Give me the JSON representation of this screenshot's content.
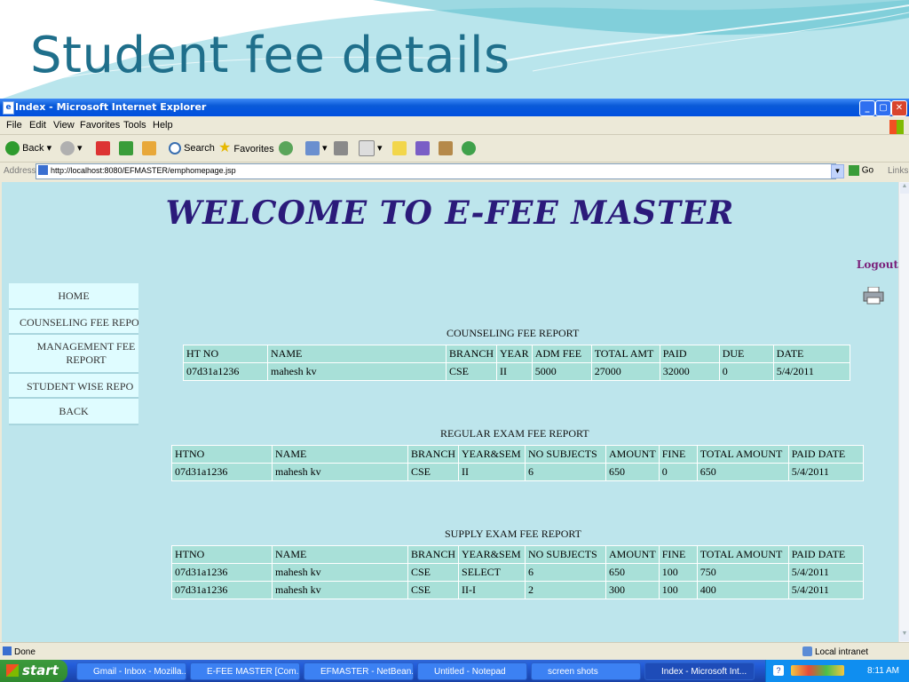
{
  "slide": {
    "title": "Student fee details"
  },
  "window": {
    "title": "Index - Microsoft Internet Explorer"
  },
  "menu": [
    "File",
    "Edit",
    "View",
    "Favorites",
    "Tools",
    "Help"
  ],
  "toolbar": {
    "back": "Back",
    "search": "Search",
    "favorites": "Favorites"
  },
  "address": {
    "label": "Address",
    "url": "http://localhost:8080/EFMASTER/emphomepage.jsp",
    "go": "Go",
    "links": "Links"
  },
  "page": {
    "heading": "WELCOME TO E-FEE MASTER",
    "logout": "Logout",
    "nav": [
      "HOME",
      "COUNSELING FEE REPO",
      "MANAGEMENT FEE REPORT",
      "STUDENT WISE REPO",
      "BACK"
    ],
    "counseling": {
      "title": "COUNSELING FEE REPORT",
      "headers": [
        "HT NO",
        "NAME",
        "BRANCH",
        "YEAR",
        "ADM FEE",
        "TOTAL AMT",
        "PAID",
        "DUE",
        "DATE"
      ],
      "rows": [
        [
          "07d31a1236",
          "mahesh kv",
          "CSE",
          "II",
          "5000",
          "27000",
          "32000",
          "0",
          "5/4/2011"
        ]
      ]
    },
    "regular": {
      "title": "REGULAR EXAM FEE REPORT",
      "headers": [
        "HTNO",
        "NAME",
        "BRANCH",
        "YEAR&SEM",
        "NO SUBJECTS",
        "AMOUNT",
        "FINE",
        "TOTAL AMOUNT",
        "PAID DATE"
      ],
      "rows": [
        [
          "07d31a1236",
          "mahesh kv",
          "CSE",
          "II",
          "6",
          "650",
          "0",
          "650",
          "5/4/2011"
        ]
      ]
    },
    "supply": {
      "title": "SUPPLY EXAM FEE REPORT",
      "headers": [
        "HTNO",
        "NAME",
        "BRANCH",
        "YEAR&SEM",
        "NO SUBJECTS",
        "AMOUNT",
        "FINE",
        "TOTAL AMOUNT",
        "PAID DATE"
      ],
      "rows": [
        [
          "07d31a1236",
          "mahesh kv",
          "CSE",
          "SELECT",
          "6",
          "650",
          "100",
          "750",
          "5/4/2011"
        ],
        [
          "07d31a1236",
          "mahesh kv",
          "CSE",
          "II-I",
          "2",
          "300",
          "100",
          "400",
          "5/4/2011"
        ]
      ]
    }
  },
  "status": {
    "text": "Done",
    "zone": "Local intranet"
  },
  "taskbar": {
    "start": "start",
    "tasks": [
      "Gmail - Inbox - Mozilla...",
      "E-FEE MASTER [Com...",
      "EFMASTER - NetBean...",
      "Untitled - Notepad",
      "screen shots",
      "Index - Microsoft Int..."
    ],
    "clock": "8:11 AM"
  },
  "colors": {
    "accent": "#1f6f8b",
    "page_bg": "#bde5ec",
    "cell_bg": "#a8e0d8",
    "heading": "#2b1a7a"
  }
}
